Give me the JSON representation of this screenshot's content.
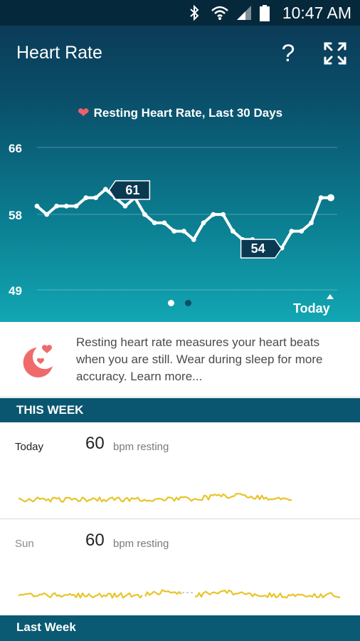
{
  "status_bar": {
    "time": "10:47 AM"
  },
  "header": {
    "title": "Heart Rate",
    "help_label": "?"
  },
  "chart": {
    "title": "Resting Heart Rate, Last 30 Days",
    "today_label": "Today",
    "highlight_max_label": "61",
    "highlight_min_label": "54"
  },
  "chart_data": {
    "type": "line",
    "title": "Resting Heart Rate, Last 30 Days",
    "xlabel": "",
    "ylabel": "",
    "y_ticks": [
      "66",
      "58",
      "49"
    ],
    "ylim": [
      49,
      66
    ],
    "x_end_label": "Today",
    "values": [
      59,
      58,
      59,
      59,
      59,
      60,
      60,
      61,
      60,
      59,
      60,
      58,
      57,
      57,
      56,
      56,
      55,
      57,
      58,
      58,
      56,
      55,
      55,
      54,
      54,
      54,
      56,
      56,
      57,
      60,
      60
    ],
    "annotations": [
      {
        "label": "61",
        "index": 7
      },
      {
        "label": "54",
        "index": 23
      }
    ],
    "grid": true
  },
  "colors": {
    "accent_heart": "#f0606a",
    "line": "#ffffff",
    "section_header": "#0a5670",
    "sparkline": "#e8c42a"
  },
  "info": {
    "text": "Resting heart rate measures your heart beats when you are still. Wear during sleep for more accuracy. Learn more..."
  },
  "this_week": {
    "header": "THIS WEEK",
    "days": [
      {
        "label": "Today",
        "value": "60",
        "unit": "bpm resting"
      },
      {
        "label": "Sun",
        "value": "60",
        "unit": "bpm resting"
      }
    ]
  },
  "last_week": {
    "header": "Last Week"
  }
}
